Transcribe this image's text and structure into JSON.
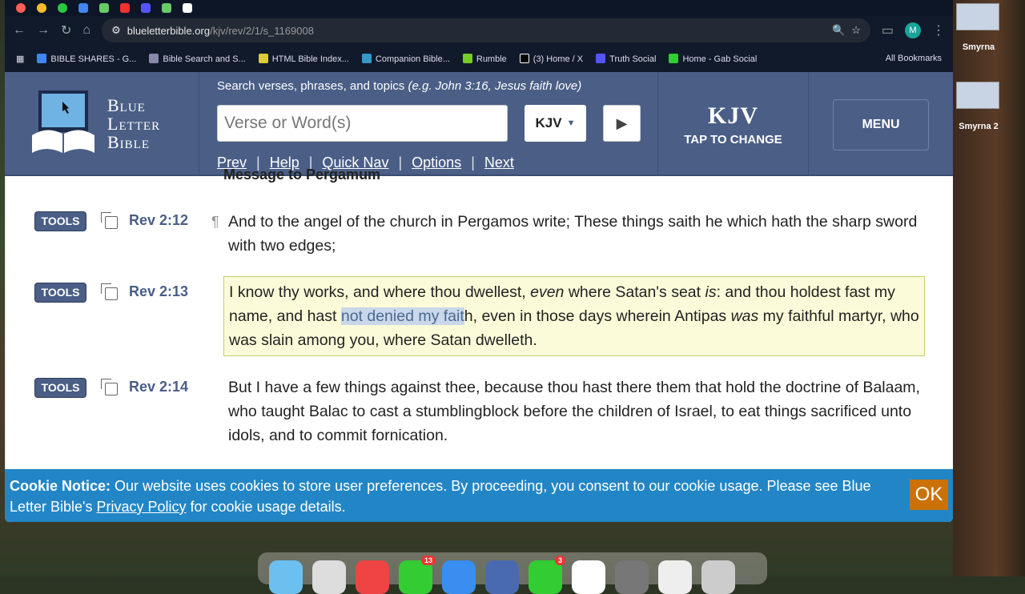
{
  "browser": {
    "url_host": "blueletterbible.org",
    "url_path": "/kjv/rev/2/1/s_1169008",
    "profile_initial": "M",
    "bookmarks": [
      "BIBLE SHARES - G...",
      "Bible Search and S...",
      "HTML Bible Index...",
      "Companion Bible...",
      "Rumble",
      "(3) Home / X",
      "Truth Social",
      "Home - Gab Social"
    ],
    "all_bookmarks": "All Bookmarks"
  },
  "desktop": {
    "icons": [
      "Smyrna",
      "Smyrna 2"
    ],
    "dock_badges": [
      "13",
      "3"
    ]
  },
  "header": {
    "logo": [
      "Blue",
      "Letter",
      "Bible"
    ],
    "search_hint": "Search verses, phrases, and topics ",
    "hint_eg": "(e.g. ",
    "hint_ex1": "John 3:16",
    "hint_comma": ", ",
    "hint_ex2": "Jesus faith love",
    "hint_close": ")",
    "search_placeholder": "Verse or Word(s)",
    "version": "KJV",
    "nav": [
      "Prev",
      "Help",
      "Quick Nav",
      "Options",
      "Next"
    ],
    "kjv_big": "KJV",
    "kjv_sub": "TAP TO CHANGE",
    "menu": "MENU"
  },
  "content": {
    "heading": "Message to Pergamum",
    "tools_label": "TOOLS",
    "pilcrow": "¶",
    "verses": [
      {
        "ref": "Rev 2:12",
        "text": "And to the angel of the church in Pergamos write; These things saith he which hath the sharp sword with two edges;"
      },
      {
        "ref": "Rev 2:13",
        "p1": "I know thy works, and where thou dwellest, ",
        "i1": "even",
        "p2": " where Satan's seat ",
        "i2": "is",
        "p3": ": and thou holdest fast my name, and hast ",
        "sel": "not denied my fait",
        "p4": "h, even in those days wherein Antipas ",
        "i3": "was",
        "p5": " my faithful martyr, who was slain among you, where Satan dwelleth."
      },
      {
        "ref": "Rev 2:14",
        "text": "But I have a few things against thee, because thou hast there them that hold the doctrine of Balaam, who taught Balac to cast a stumblingblock before the children of Israel, to eat things sacrificed unto idols, and to commit fornication."
      }
    ]
  },
  "cookie": {
    "title": "Cookie Notice:",
    "text1": " Our website uses cookies to store user preferences. By proceeding, you consent to our cookie usage. Please see Blue Letter Bible's ",
    "link": "Privacy Policy",
    "text2": " for cookie usage details.",
    "ok": "OK"
  }
}
